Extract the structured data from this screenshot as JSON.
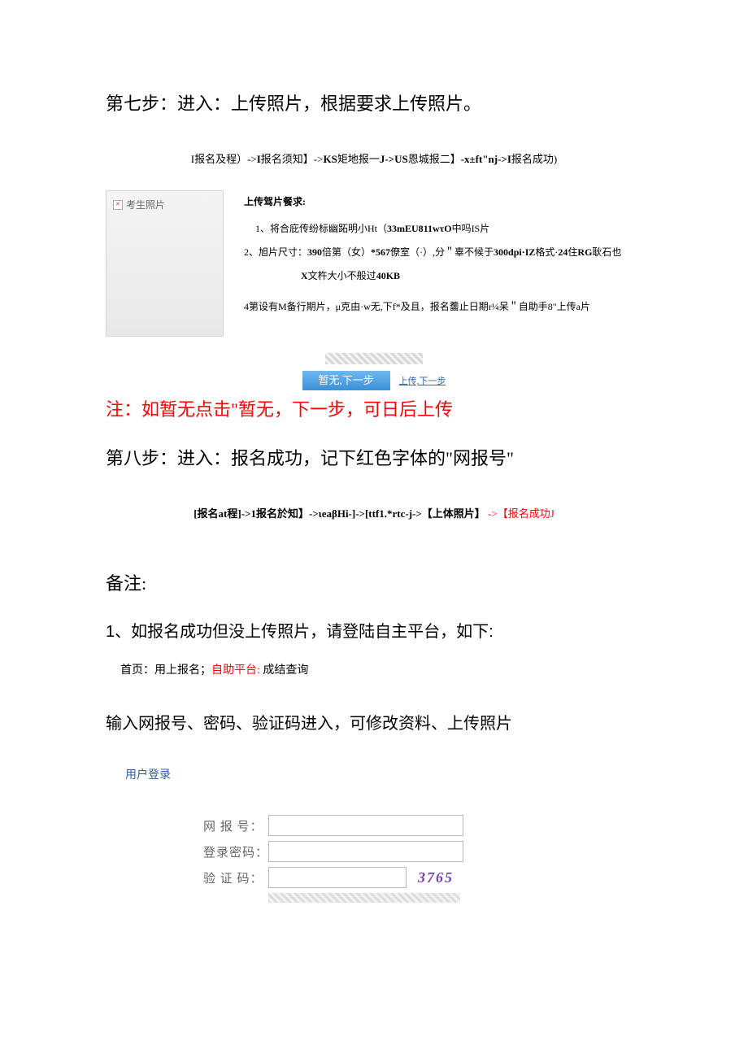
{
  "step7": "第七步：进入：上传照片，根据要求上传照片。",
  "flow1_prefix": "I报名及程）->",
  "flow1_b1": "I",
  "flow1_mid1": "报名须知】->",
  "flow1_b2": "KS",
  "flow1_mid2": "矩地报一",
  "flow1_b3": "J->US",
  "flow1_mid3": "恩城报二】",
  "flow1_b4": "-x±ft\"nj->I",
  "flow1_end": "报名成功)",
  "photo_label": "考生照片",
  "req_title": "上传驾片餐求:",
  "req1_pre": "1、将合庇传纷标幽跖明小Ht（",
  "req1_b": "33mEU811wτO",
  "req1_post": "中吗IS片",
  "req2_pre": "2、旭片尺寸：",
  "req2_b1": "390",
  "req2_mid1": "倍第（女）",
  "req2_b2": "*567",
  "req2_mid2": "僚室（·）,分＂辜不候于",
  "req2_b3": "300dpi·IZ",
  "req2_mid3": "格式·",
  "req2_b4": "24",
  "req2_mid4": "住",
  "req2_b5": "RG",
  "req2_post": "耿石也",
  "req2_sub_b": "X",
  "req2_sub_mid": "文杵大小不般过",
  "req2_sub_b2": "40KB",
  "req4_pre": "4第设有M备行期片，μ克由·w无,下f*及且，报名齹止日期r¼呆＂自助手8\"上传a片",
  "blue_btn": "暂无,下一步",
  "link_text": "上传,下一步",
  "red_note": "注：如暂无点击\"暂无，下一步，可日后上传",
  "step8": "第八步：进入：报名成功，记下红色字体的\"网报号\"",
  "flow2_main": "[报名at程]->1报名於知】->ιeaβHi-]->[ttf1.*rtc-j->【上体照片】",
  "flow2_red": "->【报名成功J",
  "remark_title": "备注:",
  "remark1": "1、如报名成功但没上传照片，请登陆自主平台，如下:",
  "nav_p1": "首页：用上报名；",
  "nav_red": "自助平台:",
  "nav_p2": " 成结查询",
  "instruction": "输入网报号、密码、验证码进入，可修改资料、上传照片",
  "login_title": "用户登录",
  "lbl_id": "网 报 号：",
  "lbl_pwd": "登录密码：",
  "lbl_cap": "验 证 码：",
  "captcha": "3765"
}
